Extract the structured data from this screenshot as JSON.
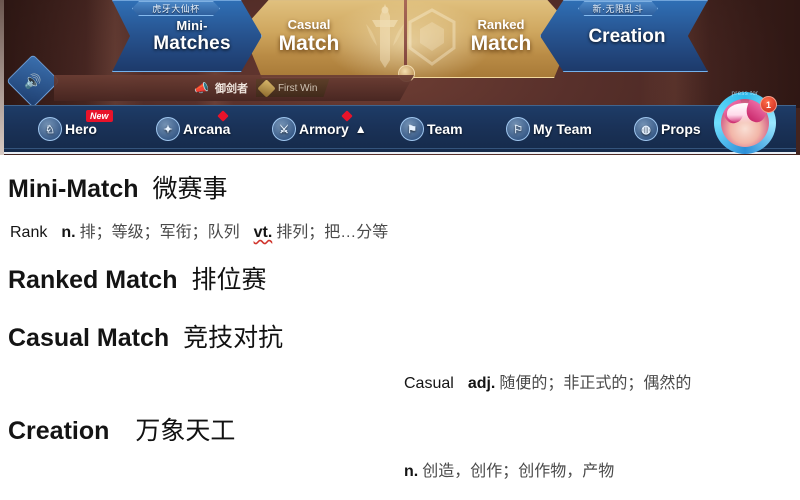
{
  "game": {
    "modes": [
      {
        "id": "mini-matches",
        "sub": "Mini-",
        "main": "Matches",
        "ribbon": "虎牙大仙杯"
      },
      {
        "id": "casual-match",
        "sub": "Casual",
        "main": "Match"
      },
      {
        "id": "ranked-match",
        "sub": "Ranked",
        "main": "Match"
      },
      {
        "id": "creation",
        "label": "Creation",
        "ribbon": "新·无限乱斗"
      }
    ],
    "announcement": {
      "horn_icon": "megaphone-icon",
      "player": "御剑者",
      "achievement": "First Win"
    },
    "sound_icon": "speaker-icon",
    "navbar": [
      {
        "id": "hero",
        "label": "Hero",
        "icon": "hero-icon",
        "badge": "New"
      },
      {
        "id": "arcana",
        "label": "Arcana",
        "icon": "arcana-icon",
        "dot": true
      },
      {
        "id": "armory",
        "label": "Armory",
        "icon": "armory-icon",
        "dot": true,
        "caret": "▲"
      },
      {
        "id": "team",
        "label": "Team",
        "icon": "team-icon"
      },
      {
        "id": "myteam",
        "label": "My Team",
        "icon": "my-team-icon"
      },
      {
        "id": "props",
        "label": "Props",
        "icon": "props-icon"
      }
    ],
    "avatar": {
      "badge_count": "1",
      "arc_text": "press for"
    },
    "colors": {
      "nav_bg": "#1a3258",
      "gold": "#cfa75f",
      "blue_chevron": "#27538f",
      "red_badge": "#e8132a"
    }
  },
  "notes": {
    "entries": [
      {
        "en": "Mini-Match",
        "cn": "微赛事"
      },
      {
        "en": "Ranked Match",
        "cn": "排位赛"
      },
      {
        "en": "Casual Match",
        "cn": "竞技对抗"
      },
      {
        "en": "Creation",
        "cn": "万象天工"
      }
    ],
    "definitions": [
      {
        "term": "Rank",
        "pos1": "n.",
        "mean1": "排；等级；军衔；队列",
        "pos2": "vt.",
        "mean2": "排列；把…分等"
      },
      {
        "term": "Casual",
        "pos1": "adj.",
        "mean1": "随便的；非正式的；偶然的"
      },
      {
        "pos1": "n.",
        "mean1": "创造，创作；创作物，产物"
      }
    ]
  }
}
